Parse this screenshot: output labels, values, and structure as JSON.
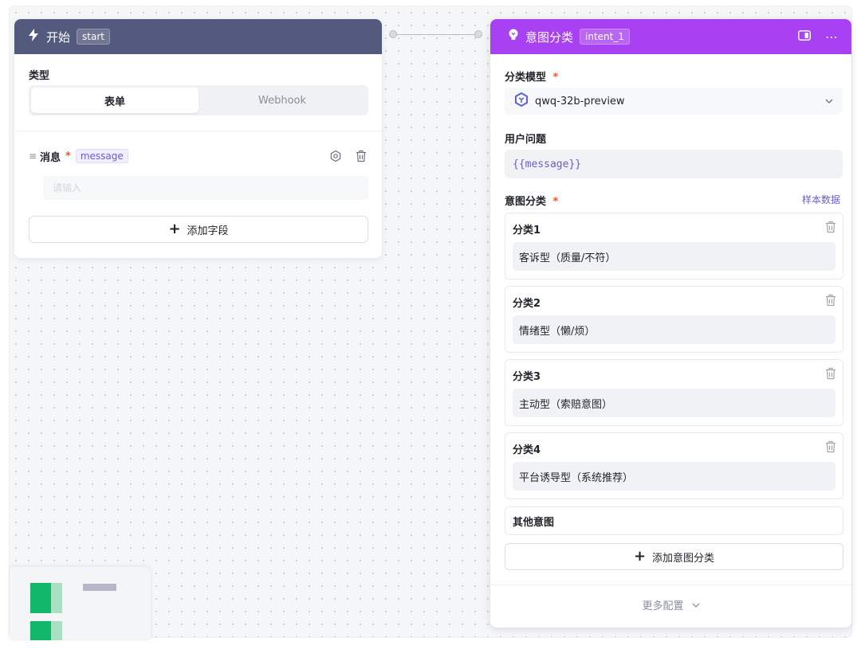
{
  "start_node": {
    "title": "开始",
    "tag": "start",
    "type_label": "类型",
    "type_options": [
      "表单",
      "Webhook"
    ],
    "selected_type": "表单",
    "field": {
      "label": "消息",
      "required_mark": "*",
      "variable": "message",
      "placeholder": "请输入"
    },
    "add_field_label": "添加字段"
  },
  "intent_node": {
    "title": "意图分类",
    "tag": "intent_1",
    "model_label": "分类模型",
    "required_mark": "*",
    "model_value": "qwq-32b-preview",
    "question_label": "用户问题",
    "question_value": "{{message}}",
    "classes_label": "意图分类",
    "sample_data_label": "样本数据",
    "categories": [
      {
        "title": "分类1",
        "value": "客诉型（质量/不符）"
      },
      {
        "title": "分类2",
        "value": "情绪型（懒/烦）"
      },
      {
        "title": "分类3",
        "value": "主动型（索赔意图）"
      },
      {
        "title": "分类4",
        "value": "平台诱导型（系统推荐）"
      }
    ],
    "other_label": "其他意图",
    "add_category_label": "添加意图分类",
    "more_config_label": "更多配置"
  },
  "colors": {
    "start_header": "#535a7e",
    "intent_header": "#a741f2",
    "accent_purple": "#6d5bd0",
    "required_red": "#f5522b",
    "minimap_green": "#12b76a"
  },
  "icons": {
    "start": "lightning-icon",
    "intent": "lightbulb-icon",
    "model": "model-logo-icon"
  }
}
